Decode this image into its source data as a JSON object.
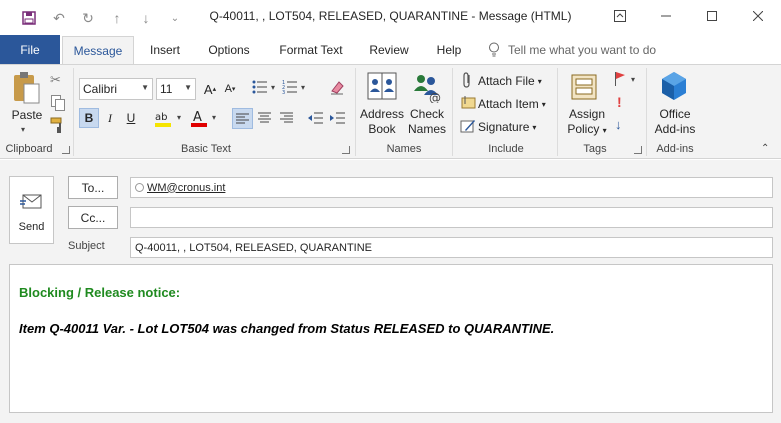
{
  "window": {
    "title": "Q-40011, , LOT504, RELEASED, QUARANTINE  -  Message (HTML)"
  },
  "tabs": {
    "file": "File",
    "items": [
      "Message",
      "Insert",
      "Options",
      "Format Text",
      "Review",
      "Help"
    ],
    "tell_me": "Tell me what you want to do"
  },
  "ribbon": {
    "clipboard": {
      "paste": "Paste",
      "group": "Clipboard"
    },
    "basic_text": {
      "font_name": "Calibri",
      "font_size": "11",
      "group": "Basic Text"
    },
    "names": {
      "address": "Address",
      "book": "Book",
      "check": "Check",
      "names_label": "Names",
      "group": "Names"
    },
    "include": {
      "attach_file": "Attach File",
      "attach_item": "Attach Item",
      "signature": "Signature",
      "group": "Include"
    },
    "tags": {
      "assign": "Assign",
      "policy": "Policy",
      "group": "Tags"
    },
    "addins": {
      "office": "Office",
      "addins": "Add-ins",
      "group": "Add-ins"
    }
  },
  "compose": {
    "send": "Send",
    "to_label": "To...",
    "cc_label": "Cc...",
    "subject_label": "Subject",
    "to_value": "WM@cronus.int",
    "cc_value": "",
    "subject_value": "Q-40011, , LOT504, RELEASED, QUARANTINE"
  },
  "body": {
    "heading": "Blocking / Release notice:",
    "text": "Item Q-40011 Var. - Lot LOT504 was changed from Status RELEASED to QUARANTINE."
  },
  "colors": {
    "file_tab": "#2b579a",
    "heading_green": "#1f8a1f",
    "ribbon_bg": "#f3f3f3"
  }
}
